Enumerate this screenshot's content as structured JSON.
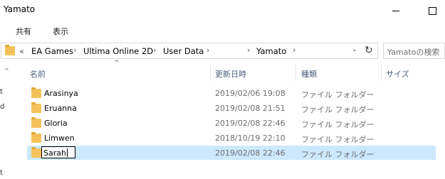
{
  "window": {
    "title": "Yamato"
  },
  "ribbon": {
    "tabs": [
      "共有",
      "表示"
    ]
  },
  "address": {
    "overflow": "«",
    "crumbs": [
      "EA Games",
      "Ultima Online 2D",
      "User Data",
      "Yamato"
    ],
    "separator": "›",
    "dropdown": "⌄",
    "refresh": "↻"
  },
  "search": {
    "placeholder": "Yamatoの検索"
  },
  "nav": {
    "scroll_up": "^",
    "glyphs": [
      "t",
      "d",
      "t"
    ]
  },
  "columns": {
    "name": "名前",
    "date": "更新日時",
    "type": "種類",
    "size": "サイズ"
  },
  "sort_indicator": "^",
  "files": [
    {
      "name": "Arasinya",
      "date": "2019/02/06 19:08",
      "type": "ファイル フォルダー"
    },
    {
      "name": "Eruanna",
      "date": "2019/02/08 21:51",
      "type": "ファイル フォルダー"
    },
    {
      "name": "Gloria",
      "date": "2019/02/08 22:46",
      "type": "ファイル フォルダー"
    },
    {
      "name": "Limwen",
      "date": "2018/10/19 22:10",
      "type": "ファイル フォルダー"
    },
    {
      "name": "Sarah",
      "date": "2019/02/08 22:46",
      "type": "ファイル フォルダー",
      "selected": true,
      "renaming": true
    }
  ],
  "colors": {
    "selection": "#cce8ff",
    "folder": "#f4c25b",
    "header_text": "#4c607a"
  }
}
